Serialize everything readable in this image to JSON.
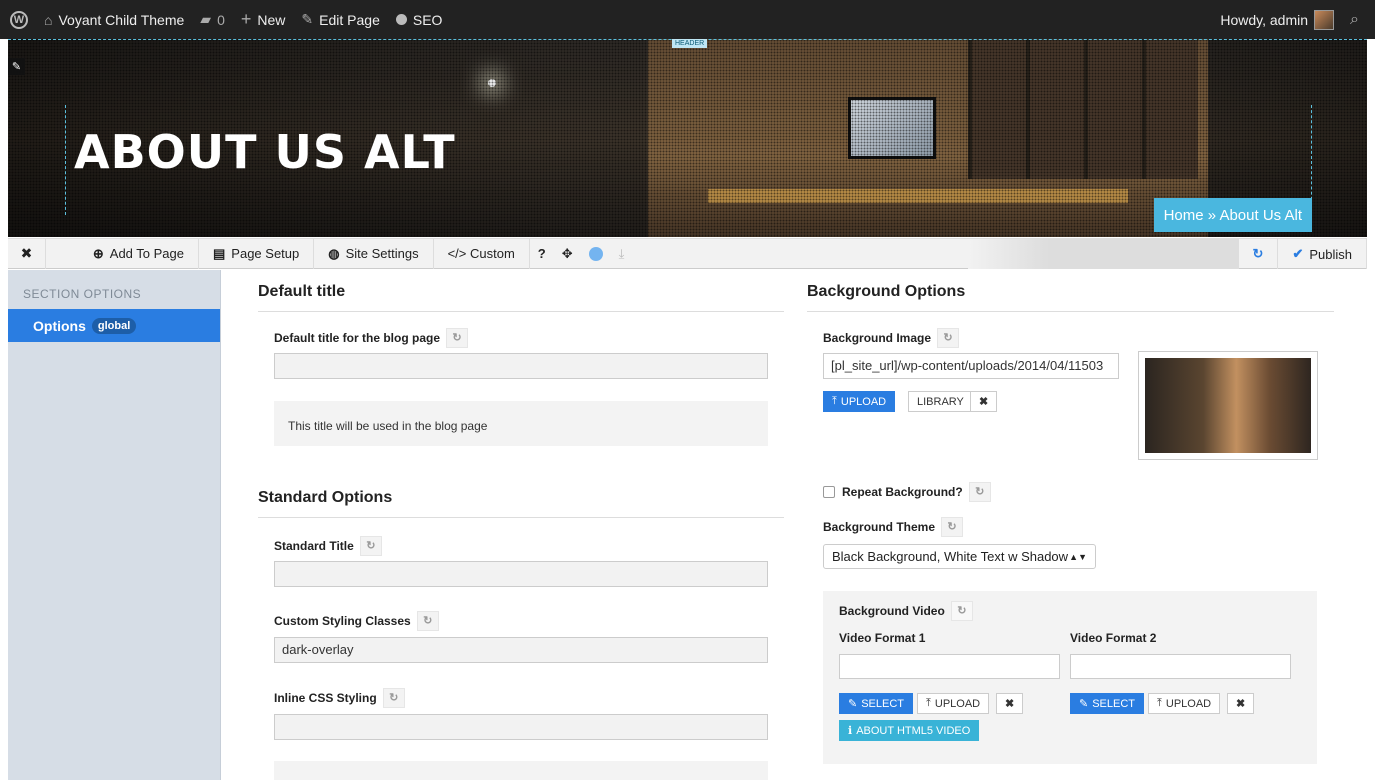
{
  "adminbar": {
    "wp_icon": "wordpress-logo-icon",
    "site_name": "Voyant Child Theme",
    "comments_count": "0",
    "new_label": "New",
    "edit_label": "Edit Page",
    "seo_label": "SEO",
    "howdy": "Howdy, admin"
  },
  "hero": {
    "header_tag": "HEADER",
    "title": "ABOUT US ALT",
    "breadcrumb": "Home » About Us Alt"
  },
  "toolbar": {
    "close": "✖",
    "add": "Add To Page",
    "page_setup": "Page Setup",
    "site_settings": "Site Settings",
    "custom": "</> Custom",
    "help": "?",
    "move": "✥",
    "publish": "Publish"
  },
  "sidebar": {
    "section_label": "SECTION OPTIONS",
    "options_label": "Options",
    "options_badge": "global"
  },
  "left": {
    "default_title_heading": "Default title",
    "default_title_label": "Default title for the blog page",
    "default_title_value": "",
    "default_title_help": "This title will be used in the blog page",
    "standard_heading": "Standard Options",
    "standard_title_label": "Standard Title",
    "standard_title_value": "",
    "custom_classes_label": "Custom Styling Classes",
    "custom_classes_value": "dark-overlay",
    "inline_css_label": "Inline CSS Styling",
    "inline_css_value": ""
  },
  "right": {
    "bg_heading": "Background Options",
    "bg_image_label": "Background Image",
    "bg_image_value": "[pl_site_url]/wp-content/uploads/2014/04/11503",
    "upload": "UPLOAD",
    "library": "LIBRARY",
    "remove": "✖",
    "repeat_label": "Repeat Background?",
    "theme_label": "Background Theme",
    "theme_value": "Black Background, White Text w Shadow",
    "video_label": "Background Video",
    "video_format1": "Video Format 1",
    "video_format2": "Video Format 2",
    "select": "SELECT",
    "about_html5": "ABOUT HTML5 VIDEO"
  }
}
